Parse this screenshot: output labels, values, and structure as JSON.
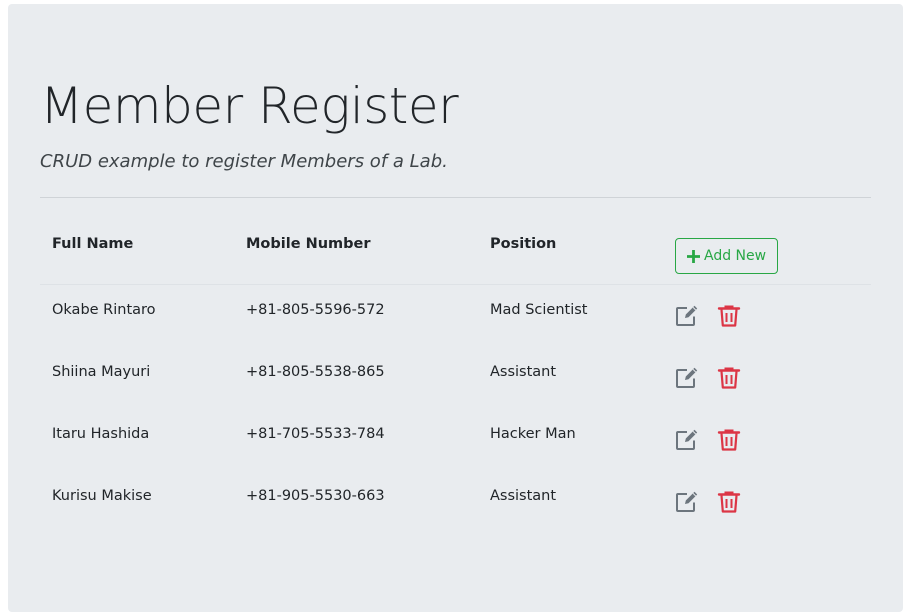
{
  "header": {
    "title": "Member Register",
    "subtitle": "CRUD example to register Members of a Lab."
  },
  "table": {
    "columns": [
      "Full Name",
      "Mobile Number",
      "Position"
    ],
    "add_button_label": "Add New",
    "rows": [
      {
        "full_name": "Okabe Rintaro",
        "mobile": "+81-805-5596-572",
        "position": "Mad Scientist"
      },
      {
        "full_name": "Shiina Mayuri",
        "mobile": "+81-805-5538-865",
        "position": "Assistant"
      },
      {
        "full_name": "Itaru Hashida",
        "mobile": "+81-705-5533-784",
        "position": "Hacker Man"
      },
      {
        "full_name": "Kurisu Makise",
        "mobile": "+81-905-5530-663",
        "position": "Assistant"
      }
    ]
  },
  "icons": {
    "add": "plus-icon",
    "edit": "edit-icon",
    "delete": "trash-icon"
  },
  "colors": {
    "background": "#e9ecef",
    "success": "#28a745",
    "danger": "#dc3545",
    "edit_icon": "#6c757d",
    "text": "#212529"
  }
}
